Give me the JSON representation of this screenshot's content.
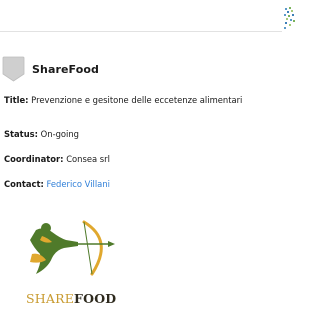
{
  "card": {
    "title": "ShareFood",
    "icon": "map-marker-icon",
    "fields": {
      "title_label": "Title:",
      "title_value": "Prevenzione e gesitone delle eccetenze alimentari",
      "status_label": "Status:",
      "status_value": "On-going",
      "coordinator_label": "Coordinator:",
      "coordinator_value": "Consea srl",
      "contact_label": "Contact:",
      "contact_value": "Federico Villani"
    },
    "colors": {
      "link": "#2f7fd8",
      "marker": "#cfcfcf"
    }
  },
  "logo": {
    "text_share": "SHARE",
    "text_food": "FOOD",
    "colors": {
      "share": "#c89a2e",
      "food": "#2e2a1e",
      "figure_green": "#4f7a2a",
      "figure_gold": "#e0a82e"
    }
  }
}
